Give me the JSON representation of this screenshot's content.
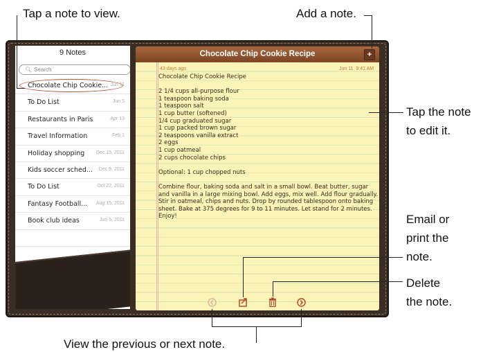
{
  "callouts": {
    "tap_note": "Tap a note to view.",
    "add_note": "Add a note.",
    "tap_edit_1": "Tap the note",
    "tap_edit_2": "to edit it.",
    "email_1": "Email or",
    "email_2": "print the",
    "email_3": "note.",
    "delete_1": "Delete",
    "delete_2": "the note.",
    "prev_next": "View the previous or next note."
  },
  "list": {
    "title": "9 Notes",
    "search_placeholder": "Search",
    "items": [
      {
        "title": "Chocolate Chip Cookie...",
        "date": "Jun 11"
      },
      {
        "title": "To Do List",
        "date": "Jun 5"
      },
      {
        "title": "Restaurants in Paris",
        "date": "Apr 13"
      },
      {
        "title": "Travel Information",
        "date": "Feb 1"
      },
      {
        "title": "Holiday shopping",
        "date": "Dec 15, 2011"
      },
      {
        "title": "Kids soccer sched...",
        "date": "Dec 9, 2011"
      },
      {
        "title": "To Do List",
        "date": "Oct 22, 2011"
      },
      {
        "title": "Fantasy Football...",
        "date": "Aug 15, 2011"
      },
      {
        "title": "Book club ideas",
        "date": "Jun 5, 2011"
      }
    ]
  },
  "note": {
    "title": "Chocolate Chip Cookie Recipe",
    "age": "43 days ago",
    "date": "Jun 11",
    "time": "9:41 AM",
    "body": "Chocolate Chip Cookie Recipe\n\n2 1/4 cups all-purpose flour\n1 teaspoon baking soda\n1 teaspoon salt\n1 cup butter (softened)\n1/4 cup graduated sugar\n1 cup packed brown sugar\n2 teaspoons vanilla extract\n2 eggs\n1 cup oatmeal\n2 cups chocolate chips\n\nOptional: 1 cup chopped nuts\n\nCombine flour, baking soda and salt in a small bowl. Beat butter, sugar and vanilla in a large mixing bowl. Add eggs, mix well. Add flour gradually. Stir in oatmeal, chips and nuts. Drop by rounded tablespoon onto baking sheet. Bake at 375 degrees for 9 to 11 minutes. Let stand for 2 minutes.\nEnjoy!"
  },
  "icons": {
    "add": "plus-icon",
    "prev": "previous-arrow-icon",
    "share": "share-icon",
    "trash": "trash-icon",
    "next": "next-arrow-icon"
  }
}
